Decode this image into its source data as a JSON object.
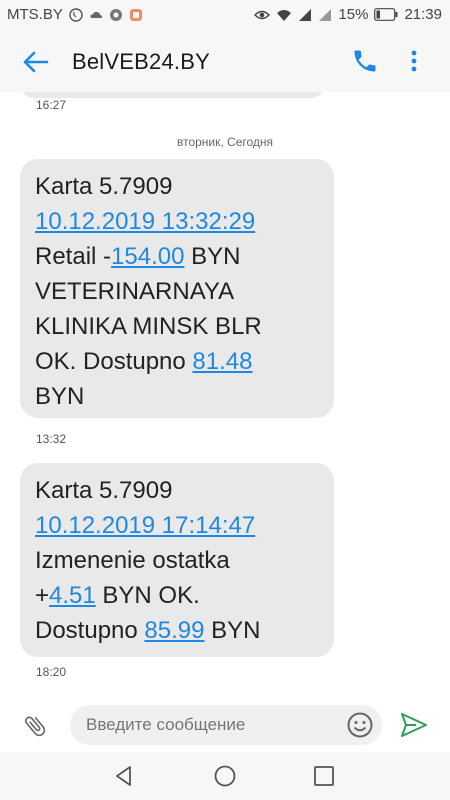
{
  "status_bar": {
    "carrier": "MTS.BY",
    "battery": "15%",
    "time": "21:39"
  },
  "app_bar": {
    "title": "BelVEB24.BY"
  },
  "thread": {
    "prev_time": "16:27",
    "date_separator": "вторник, Сегодня",
    "messages": [
      {
        "lines": {
          "l1": "Karta 5.7909",
          "date": "10.12.2019 13:32:29",
          "retail_prefix": "Retail -",
          "amount": "154.00",
          "retail_suffix": " BYN",
          "l4": "VETERINARNAYA",
          "l5": "KLINIKA MINSK BLR",
          "ok_prefix": "OK. Dostupno ",
          "balance": "81.48",
          "l7": "BYN"
        },
        "time": "13:32"
      },
      {
        "lines": {
          "l1": "Karta 5.7909",
          "date": "10.12.2019 17:14:47",
          "l3": "Izmenenie ostatka",
          "plus": "+",
          "amount": "4.51",
          "after_amount": " BYN OK.",
          "dost_prefix": "Dostupno ",
          "balance": "85.99",
          "after_balance": " BYN"
        },
        "time": "18:20"
      }
    ]
  },
  "composer": {
    "placeholder": "Введите сообщение"
  },
  "colors": {
    "accent": "#1e88e5",
    "bubble": "#e9e9e9",
    "send": "#2e9e5a"
  },
  "icons": [
    "back-arrow-icon",
    "phone-icon",
    "more-vert-icon",
    "attach-icon",
    "emoji-icon",
    "send-icon",
    "nav-back-icon",
    "nav-home-icon",
    "nav-recents-icon"
  ]
}
